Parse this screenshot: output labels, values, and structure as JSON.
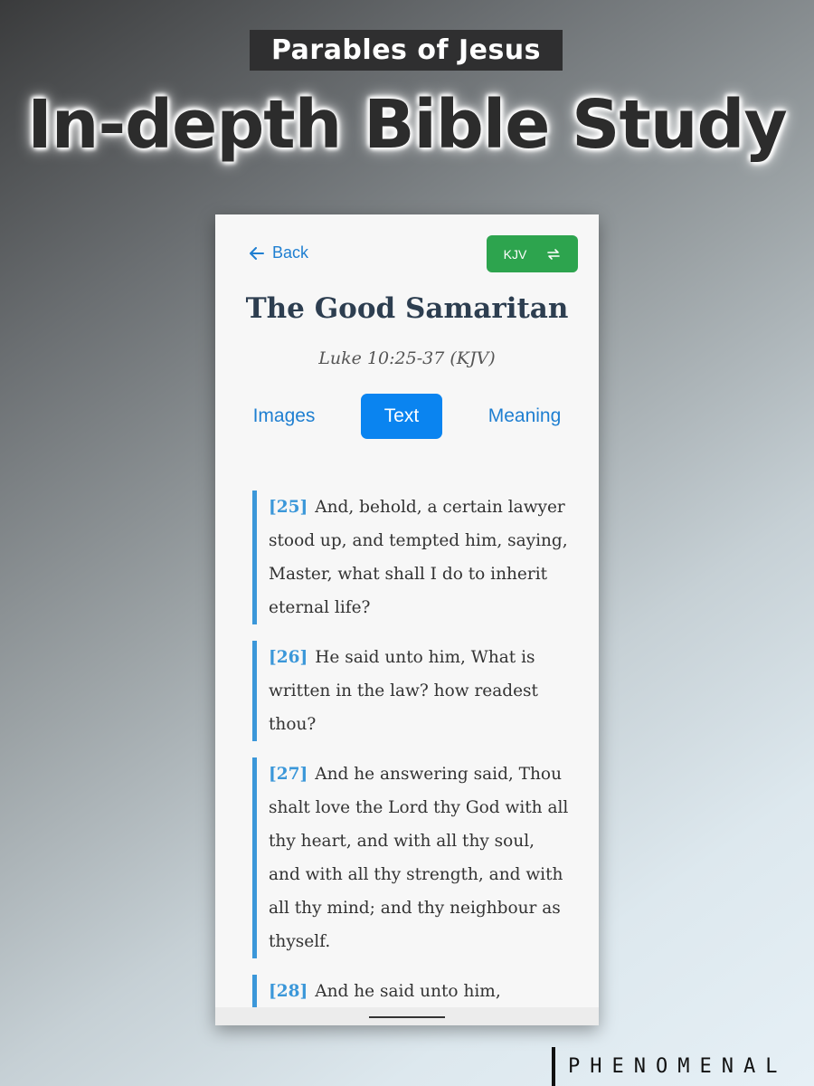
{
  "promo": {
    "tagline": "Parables of Jesus",
    "headline": "In-depth Bible Study"
  },
  "app": {
    "back_label": "Back",
    "version_label": "KJV",
    "title": "The Good Samaritan",
    "reference": "Luke 10:25-37 (KJV)",
    "tabs": [
      {
        "label": "Images",
        "active": false
      },
      {
        "label": "Text",
        "active": true
      },
      {
        "label": "Meaning",
        "active": false
      }
    ],
    "verses": [
      {
        "num": "[25]",
        "text": "And, behold, a certain lawyer stood up, and tempted him, saying, Master, what shall I do to inherit eternal life?"
      },
      {
        "num": "[26]",
        "text": "He said unto him, What is written in the law? how readest thou?"
      },
      {
        "num": "[27]",
        "text": "And he answering said, Thou shalt love the Lord thy God with all thy heart, and with all thy soul, and with all thy strength, and with all thy mind; and thy neighbour as thyself."
      },
      {
        "num": "[28]",
        "text": "And he said unto him,"
      }
    ],
    "colors": {
      "accent": "#1f7fd1",
      "version_button": "#2da44e",
      "verse_bar": "#3b97d9"
    }
  },
  "brand": "PHENOMENAL"
}
